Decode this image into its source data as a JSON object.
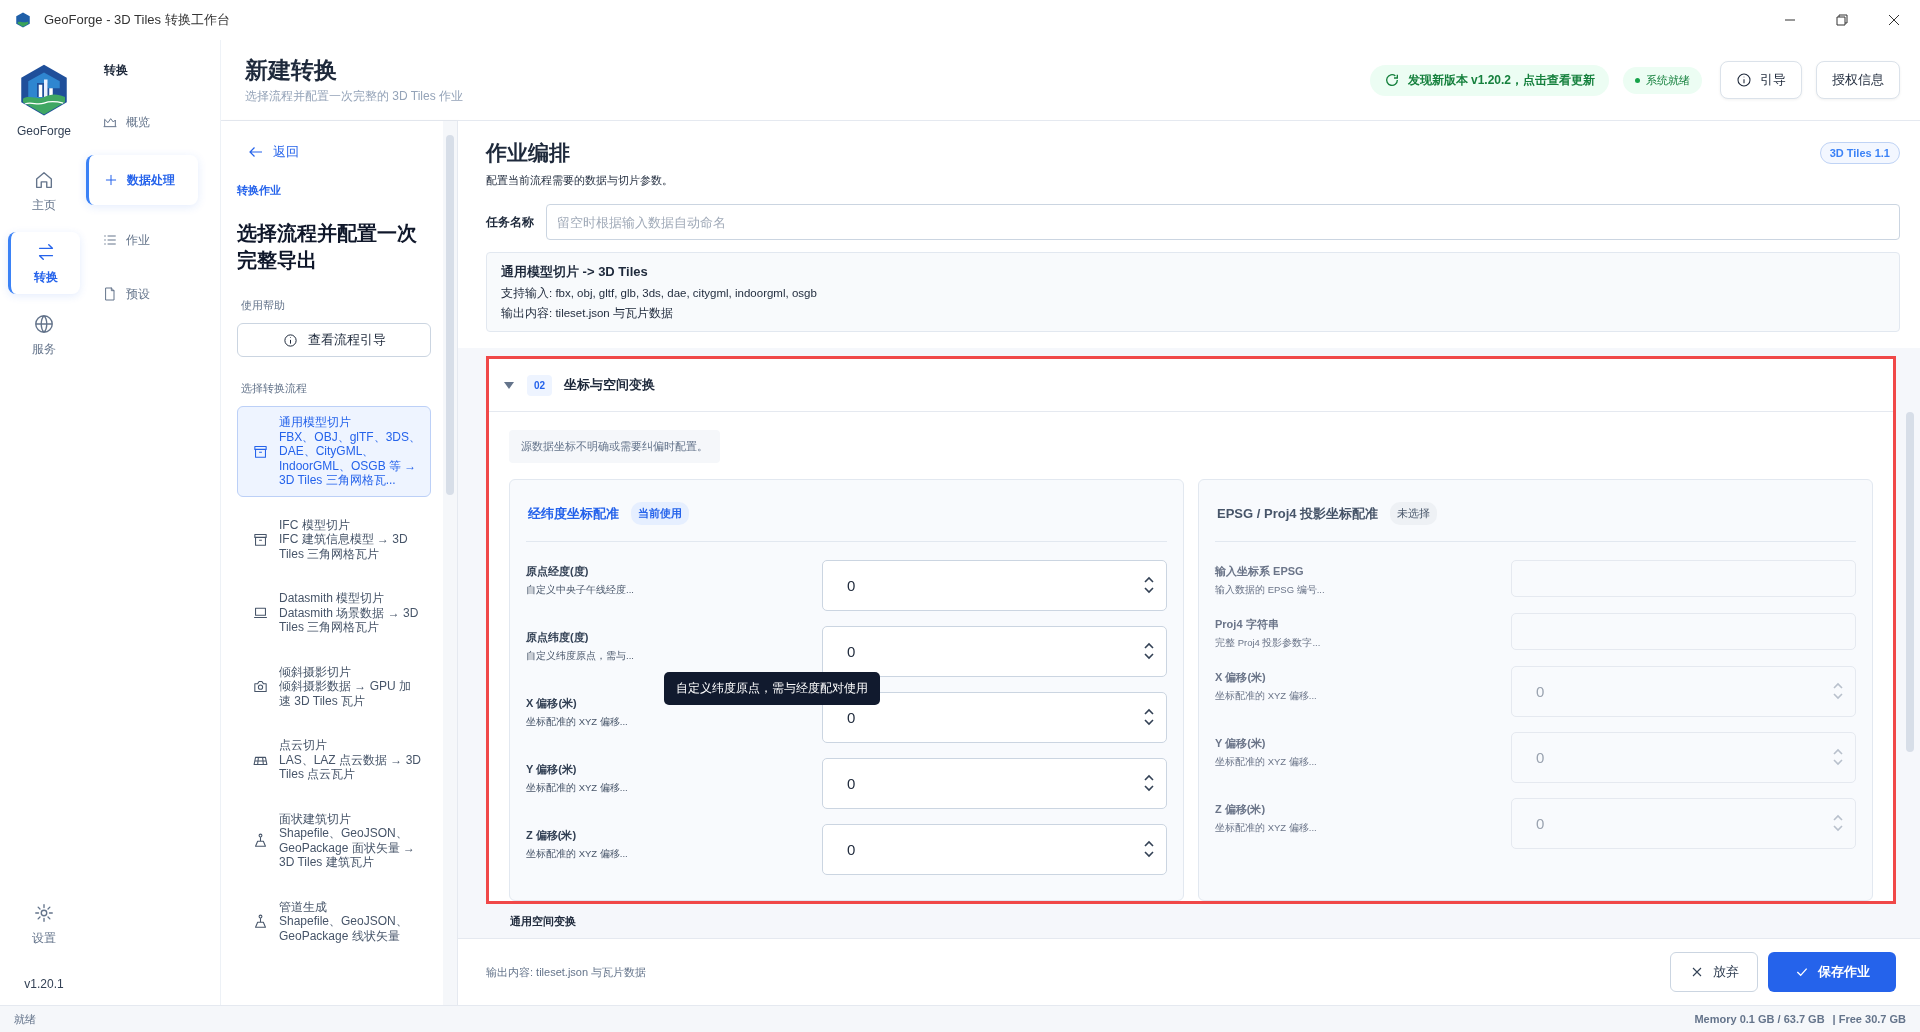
{
  "window": {
    "title": "GeoForge - 3D Tiles 转换工作台"
  },
  "brand": {
    "name": "GeoForge",
    "version": "v1.20.1"
  },
  "rail": [
    {
      "label": "主页",
      "selected": false
    },
    {
      "label": "转换",
      "selected": true
    },
    {
      "label": "服务",
      "selected": false
    }
  ],
  "rail_bottom": {
    "label": "设置"
  },
  "subnav": {
    "title": "转换",
    "items": [
      {
        "label": "概览",
        "selected": false
      },
      {
        "label": "数据处理",
        "selected": true
      },
      {
        "label": "作业",
        "selected": false
      },
      {
        "label": "预设",
        "selected": false
      }
    ]
  },
  "header": {
    "title": "新建转换",
    "subtitle": "选择流程并配置一次完整的 3D Tiles 作业",
    "update": "发现新版本 v1.20.2，点击查看更新",
    "status": "系统就绪",
    "guide_button": "引导",
    "license_button": "授权信息"
  },
  "flow_panel": {
    "back": "返回",
    "eyebrow": "转换作业",
    "title": "选择流程并配置一次完整导出",
    "help_label": "使用帮助",
    "help_button": "查看流程引导",
    "list_label": "选择转换流程",
    "flows": [
      {
        "title": "通用模型切片",
        "desc": "FBX、OBJ、glTF、3DS、DAE、CityGML、IndoorGML、OSGB 等 → 3D Tiles 三角网格瓦...",
        "selected": true
      },
      {
        "title": "IFC 模型切片",
        "desc": "IFC 建筑信息模型 → 3D Tiles 三角网格瓦片",
        "selected": false
      },
      {
        "title": "Datasmith 模型切片",
        "desc": "Datasmith 场景数据 → 3D Tiles 三角网格瓦片",
        "selected": false
      },
      {
        "title": "倾斜摄影切片",
        "desc": "倾斜摄影数据 → GPU 加速 3D Tiles 瓦片",
        "selected": false
      },
      {
        "title": "点云切片",
        "desc": "LAS、LAZ 点云数据 → 3D Tiles 点云瓦片",
        "selected": false
      },
      {
        "title": "面状建筑切片",
        "desc": "Shapefile、GeoJSON、GeoPackage 面状矢量 → 3D Tiles 建筑瓦片",
        "selected": false
      },
      {
        "title": "管道生成",
        "desc": "Shapefile、GeoJSON、GeoPackage 线状矢量",
        "selected": false
      }
    ]
  },
  "job": {
    "title": "作业编排",
    "subtitle": "配置当前流程需要的数据与切片参数。",
    "badge": "3D Tiles 1.1",
    "name_label": "任务名称",
    "name_placeholder": "留空时根据输入数据自动命名",
    "summary": {
      "title": "通用模型切片 -> 3D Tiles",
      "inputs": "支持输入: fbx, obj, gltf, glb, 3ds, dae, citygml, indoorgml, osgb",
      "outputs": "输出内容: tileset.json 与瓦片数据"
    }
  },
  "section": {
    "number": "02",
    "title": "坐标与空间变换",
    "expanded": true,
    "hint": "源数据坐标不明确或需要纠偏时配置。",
    "next_section": "通用空间变换",
    "panels": [
      {
        "title": "经纬度坐标配准",
        "tag": "当前使用",
        "active": true,
        "fields": [
          {
            "label": "原点经度(度)",
            "hint": "自定义中央子午线经度...",
            "kind": "number",
            "value": "0"
          },
          {
            "label": "原点纬度(度)",
            "hint": "自定义纬度原点，需与...",
            "kind": "number",
            "value": "0",
            "tooltip": "自定义纬度原点，需与经度配对使用"
          },
          {
            "label": "X 偏移(米)",
            "hint": "坐标配准的 XYZ 偏移...",
            "kind": "number",
            "value": "0"
          },
          {
            "label": "Y 偏移(米)",
            "hint": "坐标配准的 XYZ 偏移...",
            "kind": "number",
            "value": "0"
          },
          {
            "label": "Z 偏移(米)",
            "hint": "坐标配准的 XYZ 偏移...",
            "kind": "number",
            "value": "0"
          }
        ]
      },
      {
        "title": "EPSG / Proj4 投影坐标配准",
        "tag": "未选择",
        "active": false,
        "fields": [
          {
            "label": "输入坐标系 EPSG",
            "hint": "输入数据的 EPSG 编号...",
            "kind": "text"
          },
          {
            "label": "Proj4 字符串",
            "hint": "完整 Proj4 投影参数字...",
            "kind": "text"
          },
          {
            "label": "X 偏移(米)",
            "hint": "坐标配准的 XYZ 偏移...",
            "kind": "number",
            "placeholder": "0"
          },
          {
            "label": "Y 偏移(米)",
            "hint": "坐标配准的 XYZ 偏移...",
            "kind": "number",
            "placeholder": "0"
          },
          {
            "label": "Z 偏移(米)",
            "hint": "坐标配准的 XYZ 偏移...",
            "kind": "number",
            "placeholder": "0"
          }
        ]
      }
    ]
  },
  "footer": {
    "output": "输出内容: tileset.json 与瓦片数据",
    "discard": "放弃",
    "save": "保存作业"
  },
  "status_bar": {
    "left": "就绪",
    "memory": "Memory  0.1 GB / 63.7 GB",
    "free": "| Free 30.7 GB"
  }
}
